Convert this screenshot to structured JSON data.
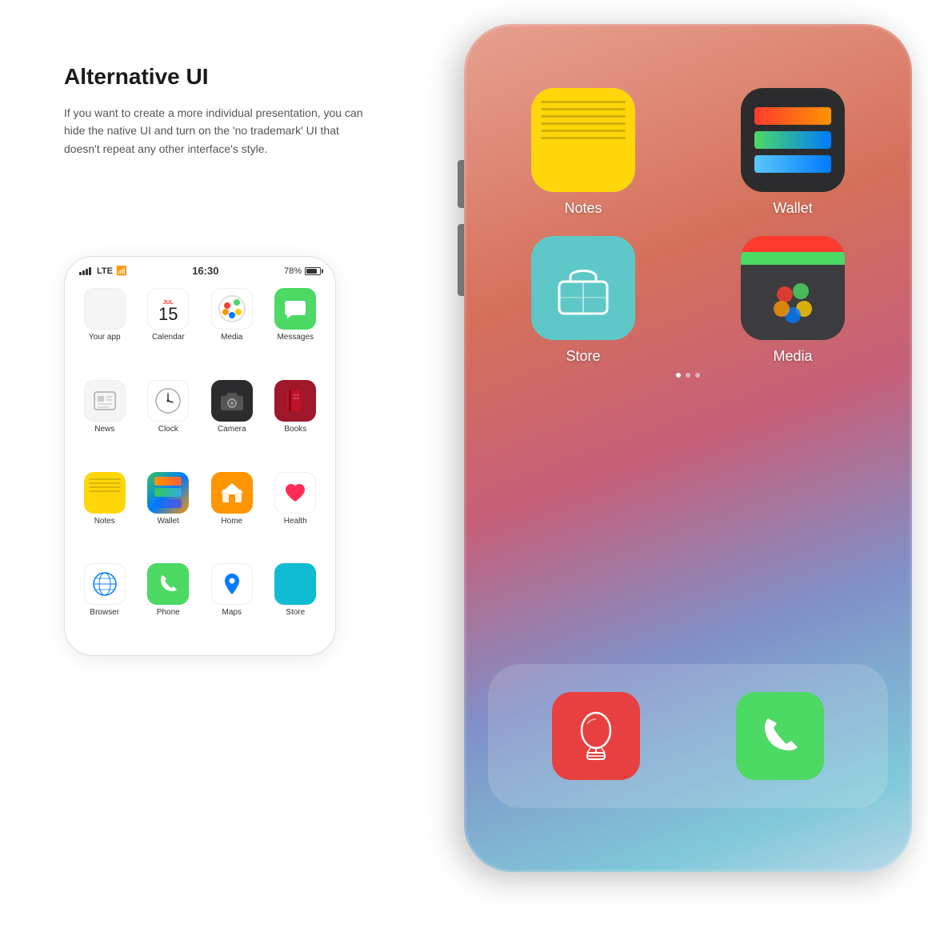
{
  "heading": {
    "title": "Alternative UI",
    "description": "If you want to create a more individual presentation, you can hide the native UI and turn on the 'no trademark' UI that doesn't repeat any other interface's style."
  },
  "status_bar": {
    "signal": "LTE",
    "time": "16:30",
    "battery": "78%"
  },
  "small_phone": {
    "apps": [
      {
        "id": "your-app",
        "label": "Your app",
        "icon": "⬜"
      },
      {
        "id": "calendar",
        "label": "Calendar",
        "icon": "15"
      },
      {
        "id": "media",
        "label": "Media",
        "icon": "🎨"
      },
      {
        "id": "messages",
        "label": "Messages",
        "icon": "💬"
      },
      {
        "id": "news",
        "label": "News",
        "icon": "📰"
      },
      {
        "id": "clock",
        "label": "Clock",
        "icon": "🕐"
      },
      {
        "id": "camera",
        "label": "Camera",
        "icon": "📷"
      },
      {
        "id": "books",
        "label": "Books",
        "icon": "📕"
      },
      {
        "id": "notes",
        "label": "Notes",
        "icon": "📝"
      },
      {
        "id": "wallet",
        "label": "Wallet",
        "icon": "💳"
      },
      {
        "id": "home",
        "label": "Home",
        "icon": "🏠"
      },
      {
        "id": "health",
        "label": "Health",
        "icon": "❤️"
      },
      {
        "id": "browser",
        "label": "Browser",
        "icon": "🧭"
      },
      {
        "id": "phone",
        "label": "Phone",
        "icon": "📞"
      },
      {
        "id": "maps",
        "label": "Maps",
        "icon": "📍"
      },
      {
        "id": "store",
        "label": "Store",
        "icon": "🏪"
      }
    ]
  },
  "big_phone": {
    "apps": [
      {
        "id": "notes",
        "label": "Notes"
      },
      {
        "id": "wallet",
        "label": "Wallet"
      },
      {
        "id": "store",
        "label": "Store"
      },
      {
        "id": "media",
        "label": "Media"
      }
    ]
  }
}
